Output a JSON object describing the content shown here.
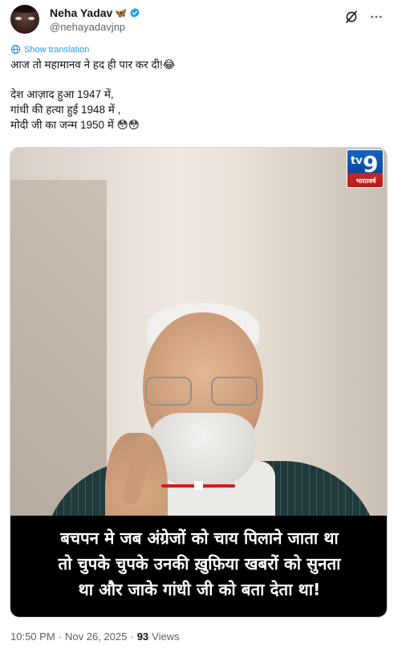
{
  "author": {
    "display_name": "Neha Yadav",
    "name_emoji": "butterfly-icon",
    "handle": "@nehayadavjnp",
    "verified": true,
    "verified_color": "#1d9bf0"
  },
  "translation": {
    "label": "Show translation",
    "color": "#1d9bf0"
  },
  "tweet": {
    "line1": "आज तो महामानव ने हद ही पार कर दी!😂",
    "line2": "देश आज़ाद हुआ 1947 में,",
    "line3": "गांधी की हत्या हुई 1948 में ,",
    "line4": "मोदी जी का जन्म 1950 में 😳😳"
  },
  "media": {
    "channel_logo": {
      "tv": "tv",
      "number": "9",
      "sub": "भारतवर्ष"
    },
    "caption": {
      "line1": "बचपन मे जब अंग्रेजों को चाय पिलाने जाता था",
      "line2": "तो चुपके चुपके उनकी ख़ुफ़िया खबरों को सुनता",
      "line3": "था और जाके गांधी जी को बता देता था!"
    }
  },
  "meta": {
    "time": "10:50 PM",
    "separator1": "·",
    "date": "Nov 26, 2025",
    "separator2": "·",
    "views_count": "93",
    "views_label": "Views"
  }
}
